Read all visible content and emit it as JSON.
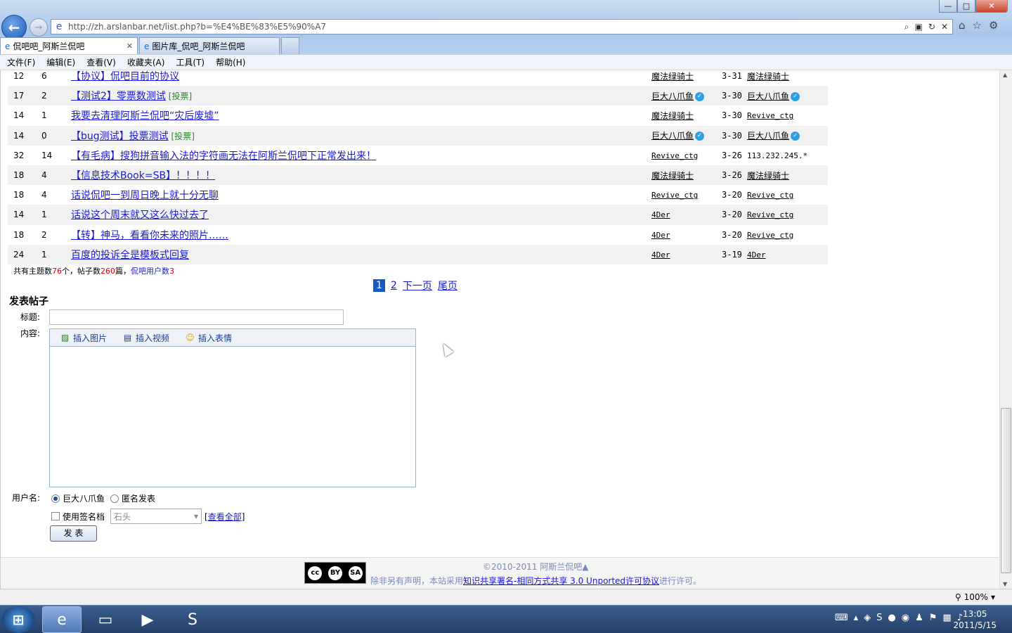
{
  "browser": {
    "url": "http://zh.arslanbar.net/list.php?b=%E4%BE%83%E5%90%A7",
    "tabs": [
      {
        "label": "侃吧吧_阿斯兰侃吧",
        "active": true
      },
      {
        "label": "图片库_侃吧_阿斯兰侃吧",
        "active": false
      }
    ],
    "menu": [
      "文件(F)",
      "编辑(E)",
      "查看(V)",
      "收藏夹(A)",
      "工具(T)",
      "帮助(H)"
    ],
    "window_controls": {
      "minimize": "—",
      "maximize": "□",
      "close": "✕"
    }
  },
  "topics": [
    {
      "views": "12",
      "replies": "6",
      "title": "【协议】侃吧目前的协议",
      "vote": "",
      "author": "魔法绿骑士",
      "author_verified": false,
      "date": "3-31",
      "last": "魔法绿骑士",
      "last_verified": false,
      "last_type": "name"
    },
    {
      "views": "17",
      "replies": "2",
      "title": "【测试2】零票数测试",
      "vote": "投票",
      "author": "巨大八爪鱼",
      "author_verified": true,
      "date": "3-30",
      "last": "巨大八爪鱼",
      "last_verified": true,
      "last_type": "name"
    },
    {
      "views": "14",
      "replies": "1",
      "title": "我要去清理阿斯兰侃吧“灾后废墟”",
      "vote": "",
      "author": "魔法绿骑士",
      "author_verified": false,
      "date": "3-30",
      "last": "Revive_ctg",
      "last_verified": false,
      "last_type": "mono"
    },
    {
      "views": "14",
      "replies": "0",
      "title": "【bug测试】投票测试",
      "vote": "投票",
      "author": "巨大八爪鱼",
      "author_verified": true,
      "date": "3-30",
      "last": "巨大八爪鱼",
      "last_verified": true,
      "last_type": "name"
    },
    {
      "views": "32",
      "replies": "14",
      "title": "【有毛病】搜狗拼音输入法的字符画无法在阿斯兰侃吧下正常发出来！",
      "vote": "",
      "author": "Revive_ctg",
      "author_verified": false,
      "date": "3-26",
      "last": "113.232.245.*",
      "last_verified": false,
      "last_type": "plain"
    },
    {
      "views": "18",
      "replies": "4",
      "title": "【信息技术Book=SB】！！！！",
      "vote": "",
      "author": "魔法绿骑士",
      "author_verified": false,
      "date": "3-26",
      "last": "魔法绿骑士",
      "last_verified": false,
      "last_type": "name"
    },
    {
      "views": "18",
      "replies": "4",
      "title": "话说侃吧一到周日晚上就十分无聊",
      "vote": "",
      "author": "Revive_ctg",
      "author_verified": false,
      "date": "3-20",
      "last": "Revive_ctg",
      "last_verified": false,
      "last_type": "mono"
    },
    {
      "views": "14",
      "replies": "1",
      "title": "话说这个周末就又这么快过去了",
      "vote": "",
      "author": "4Der",
      "author_verified": false,
      "date": "3-20",
      "last": "Revive_ctg",
      "last_verified": false,
      "last_type": "mono"
    },
    {
      "views": "18",
      "replies": "2",
      "title": "【转】神马，看看你未来的照片……",
      "vote": "",
      "author": "4Der",
      "author_verified": false,
      "date": "3-20",
      "last": "Revive_ctg",
      "last_verified": false,
      "last_type": "mono"
    },
    {
      "views": "24",
      "replies": "1",
      "title": "百度的投诉全是模板式回复",
      "vote": "",
      "author": "4Der",
      "author_verified": false,
      "date": "3-19",
      "last": "4Der",
      "last_verified": false,
      "last_type": "mono"
    }
  ],
  "stats": {
    "prefix": "共有主题数",
    "topic_count": "76",
    "mid1": "个，帖子数",
    "post_count": "260",
    "mid2": "篇，",
    "users_link": "侃吧用户数",
    "user_count": "3"
  },
  "pager": {
    "current": "1",
    "page2": "2",
    "next": "下一页",
    "last": "尾页"
  },
  "post_form": {
    "heading": "发表帖子",
    "title_label": "标题:",
    "content_label": "内容:",
    "tools": [
      "插入图片",
      "插入视频",
      "插入表情"
    ],
    "user_label": "用户名:",
    "user_option": "巨大八爪鱼",
    "anon_option": "匿名发表",
    "signature_label": "使用签名档",
    "signature_value": "石头",
    "view_all": "查看全部",
    "submit": "发 表"
  },
  "footer": {
    "copyright": "©2010-2011 阿斯兰侃吧▲",
    "license_prefix": "除非另有声明，本站采用",
    "license_link": "知识共享署名-相同方式共享 3.0 Unported许可协议",
    "license_suffix": "进行许可。",
    "cc_badge": [
      "cc",
      "BY",
      "SA"
    ]
  },
  "statusbar": {
    "zoom": "100%"
  },
  "taskbar": {
    "time": "13:05",
    "date": "2011/5/15"
  }
}
